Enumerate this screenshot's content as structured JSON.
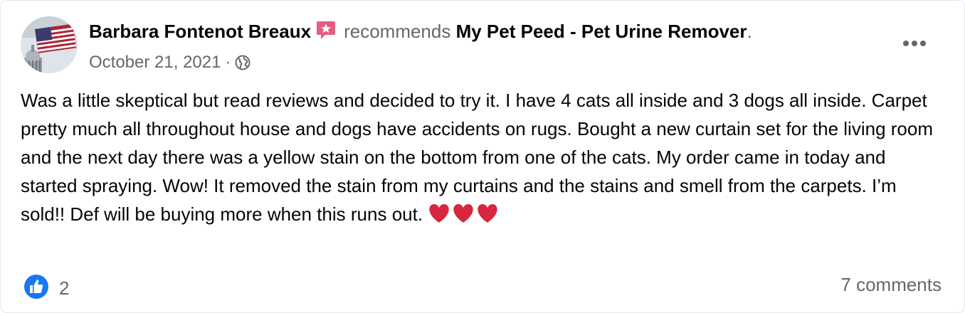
{
  "post": {
    "author": "Barbara Fontenot Breaux",
    "recommends_text": "recommends",
    "page_name": "My Pet Peed - Pet Urine Remover",
    "title_end": ".",
    "date": "October 21, 2021",
    "separator": "·",
    "audience_icon": "globe-icon",
    "badge_icon": "recommendation-star-icon",
    "body": "Was a little skeptical but read reviews and decided to try it. I have 4 cats all inside and 3 dogs all inside. Carpet pretty much all throughout house and dogs have accidents on rugs. Bought a new curtain set for the living room and the next day there was a yellow stain on the bottom from one of the cats. My order came in today and started spraying. Wow! It removed the stain from my curtains and the stains and smell from the carpets. I’m sold!! Def will be buying more when this runs out.",
    "emoji": "heart-icon x3"
  },
  "footer": {
    "like_count": "2",
    "comments": "7 comments"
  },
  "colors": {
    "like_blue": "#1877f2",
    "badge_pink": "#e35d82",
    "secondary_text": "#65676b"
  }
}
